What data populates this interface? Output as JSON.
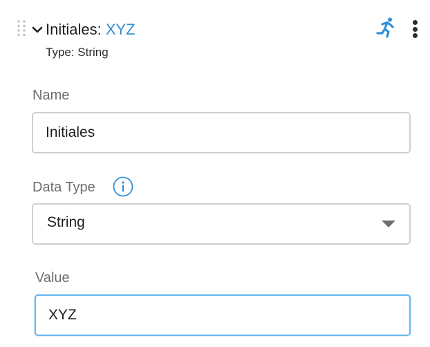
{
  "header": {
    "title_prefix": "Initiales: ",
    "title_value": "XYZ",
    "subtitle": "Type: String",
    "run_icon": "running-figure-icon",
    "more_icon": "kebab-menu-icon"
  },
  "form": {
    "name_label": "Name",
    "name_value": "Initiales",
    "data_type_label": "Data Type",
    "data_type_selected": "String",
    "value_label": "Value",
    "value_value": "XYZ"
  },
  "colors": {
    "accent": "#2f8fd6",
    "focus_border": "#68b8ef",
    "border": "#cfcfcf",
    "label": "#6d6d6d"
  }
}
